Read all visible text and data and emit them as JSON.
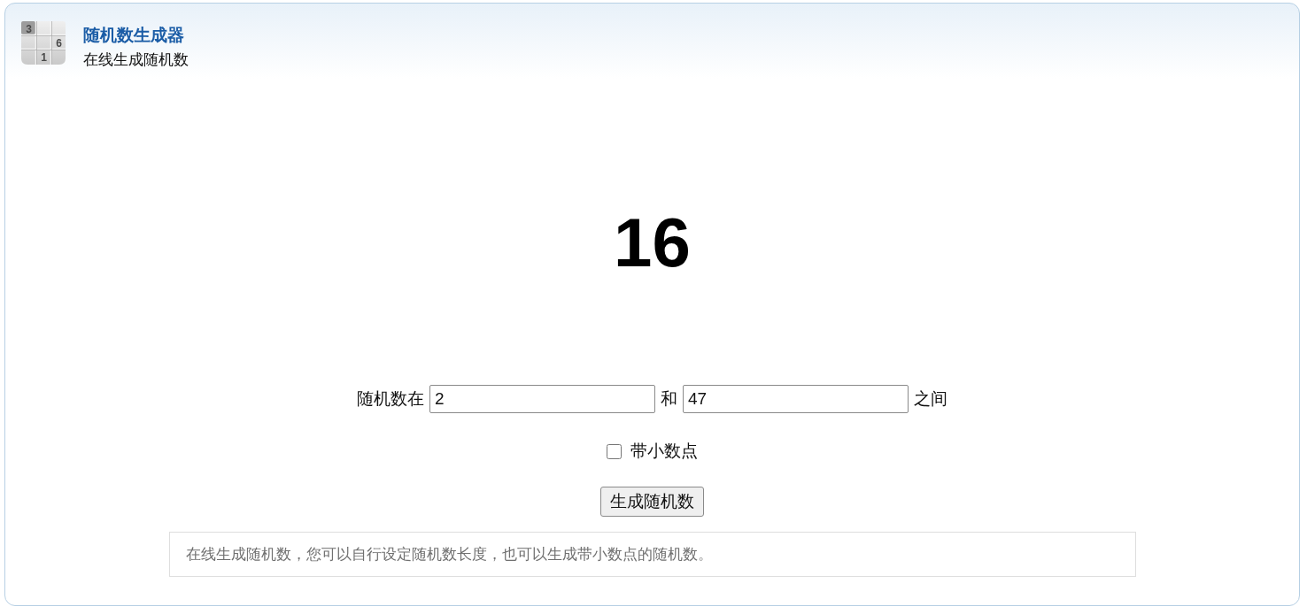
{
  "header": {
    "logo": {
      "rows": [
        [
          "3",
          null,
          null
        ],
        [
          null,
          null,
          "6"
        ],
        [
          null,
          "1",
          null
        ]
      ]
    },
    "title": "随机数生成器",
    "subtitle": "在线生成随机数"
  },
  "result": "16",
  "range": {
    "prefix": "随机数在",
    "min": {
      "value": "2"
    },
    "joiner": "和",
    "max": {
      "value": "47"
    },
    "suffix": "之间"
  },
  "decimal_option": {
    "label": "带小数点",
    "checked": false
  },
  "generate_button": {
    "label": "生成随机数"
  },
  "description": "在线生成随机数，您可以自行设定随机数长度，也可以生成带小数点的随机数。"
}
